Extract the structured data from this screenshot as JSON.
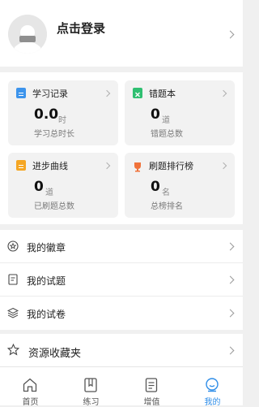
{
  "profile": {
    "login_label": "点击登录"
  },
  "stats": {
    "study_record": {
      "title": "学习记录",
      "value": "0.0",
      "unit": "时",
      "caption": "学习总时长",
      "color": "#3d94ec"
    },
    "wrong_book": {
      "title": "错题本",
      "value": "0",
      "unit": "道",
      "caption": "错题总数",
      "color": "#2fbf71"
    },
    "progress_curve": {
      "title": "进步曲线",
      "value": "0",
      "unit": "道",
      "caption": "已刷题总数",
      "color": "#f5a623"
    },
    "ranking": {
      "title": "刷题排行榜",
      "value": "0",
      "unit": "名",
      "caption": "总榜排名",
      "color": "#f0723a"
    }
  },
  "menu": {
    "items": [
      {
        "label": "我的徽章",
        "icon": "badge-icon"
      },
      {
        "label": "我的试题",
        "icon": "document-icon"
      },
      {
        "label": "我的试卷",
        "icon": "layers-icon"
      }
    ],
    "favorites": {
      "label": "资源收藏夹",
      "icon": "star-icon"
    }
  },
  "tabbar": {
    "tabs": [
      {
        "label": "首页",
        "icon": "home-icon"
      },
      {
        "label": "练习",
        "icon": "practice-icon"
      },
      {
        "label": "增值",
        "icon": "value-added-icon"
      },
      {
        "label": "我的",
        "icon": "profile-icon",
        "active": true
      }
    ],
    "active_color": "#2e8de8"
  }
}
